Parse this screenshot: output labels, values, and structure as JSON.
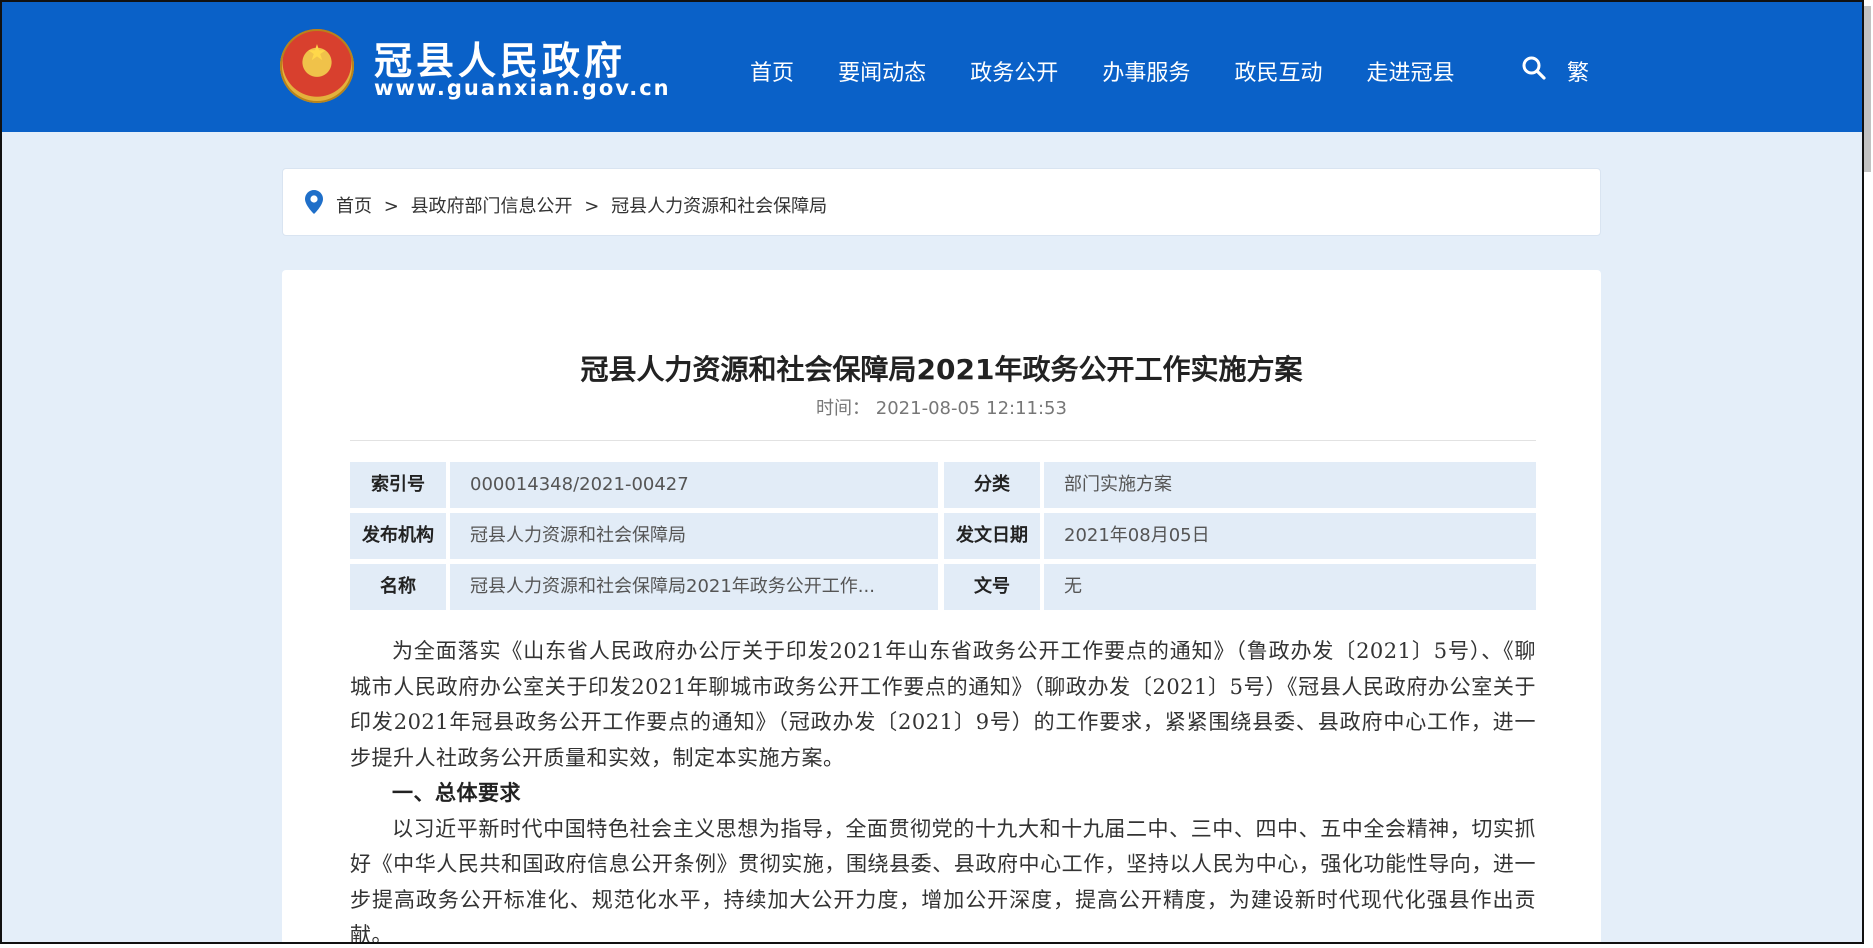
{
  "header": {
    "site_name": "冠县人民政府",
    "site_url": "www.guanxian.gov.cn",
    "nav": [
      "首页",
      "要闻动态",
      "政务公开",
      "办事服务",
      "政民互动",
      "走进冠县"
    ],
    "traditional_label": "繁",
    "brand_color": "#0a61c8"
  },
  "breadcrumb": {
    "items": [
      "首页",
      "县政府部门信息公开",
      "冠县人力资源和社会保障局"
    ],
    "separator": ">"
  },
  "article": {
    "title": "冠县人力资源和社会保障局2021年政务公开工作实施方案",
    "time_label": "时间：",
    "time": "2021-08-05 12:11:53",
    "meta": [
      {
        "key1": "索引号",
        "val1": "000014348/2021-00427",
        "key2": "分类",
        "val2": "部门实施方案"
      },
      {
        "key1": "发布机构",
        "val1": "冠县人力资源和社会保障局",
        "key2": "发文日期",
        "val2": "2021年08月05日"
      },
      {
        "key1": "名称",
        "val1": "冠县人力资源和社会保障局2021年政务公开工作...",
        "key2": "文号",
        "val2": "无"
      }
    ],
    "paragraphs": [
      "为全面落实《山东省人民政府办公厅关于印发2021年山东省政务公开工作要点的通知》（鲁政办发〔2021〕5号）、《聊城市人民政府办公室关于印发2021年聊城市政务公开工作要点的通知》（聊政办发〔2021〕5号）《冠县人民政府办公室关于印发2021年冠县政务公开工作要点的通知》（冠政办发〔2021〕9号）的工作要求，紧紧围绕县委、县政府中心工作，进一步提升人社政务公开质量和实效，制定本实施方案。",
      "一、总体要求",
      "以习近平新时代中国特色社会主义思想为指导，全面贯彻党的十九大和十九届二中、三中、四中、五中全会精神，切实抓好《中华人民共和国政府信息公开条例》贯彻实施，围绕县委、县政府中心工作，坚持以人民为中心，强化功能性导向，进一步提高政务公开标准化、规范化水平，持续加大公开力度，增加公开深度，提高公开精度，为建设新时代现代化强县作出贡献。"
    ]
  }
}
